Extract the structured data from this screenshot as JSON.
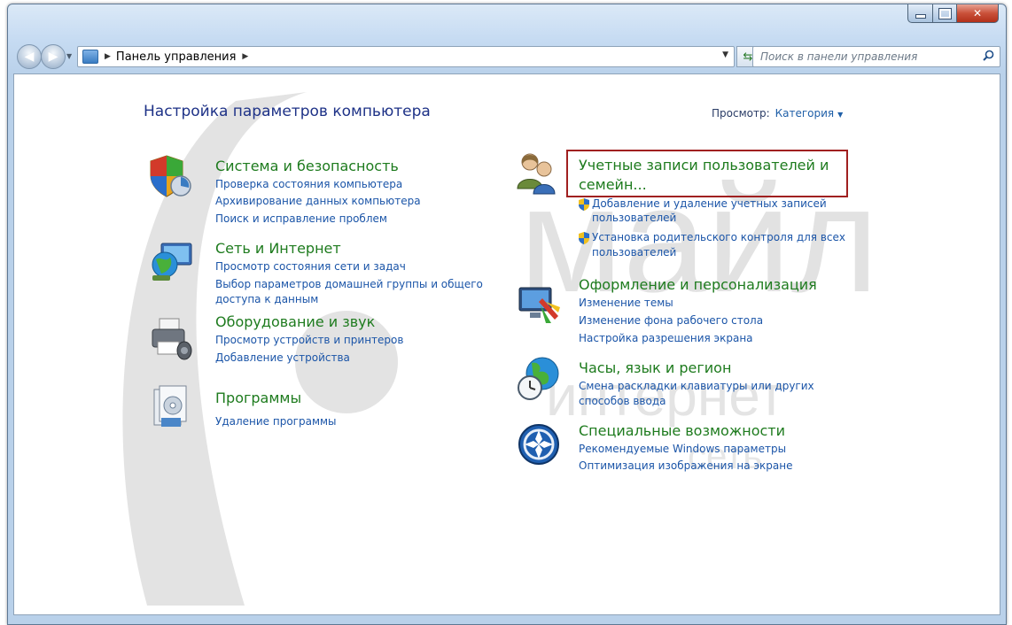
{
  "address": {
    "crumb": "Панель управления",
    "search_placeholder": "Поиск в панели управления"
  },
  "header": {
    "title": "Настройка параметров компьютера",
    "view_label": "Просмотр:",
    "view_value": "Категория"
  },
  "left": [
    {
      "icon": "shield-icon",
      "title": "Система и безопасность",
      "links": [
        "Проверка состояния компьютера",
        "Архивирование данных компьютера",
        "Поиск и исправление проблем"
      ]
    },
    {
      "icon": "network-icon",
      "title": "Сеть и Интернет",
      "links": [
        "Просмотр состояния сети и задач",
        "Выбор параметров домашней группы и общего",
        "доступа к данным"
      ]
    },
    {
      "icon": "printer-icon",
      "title": "Оборудование и звук",
      "links": [
        "Просмотр устройств и принтеров",
        "Добавление устройства"
      ]
    },
    {
      "icon": "programs-icon",
      "title": "Программы",
      "links": [
        "Удаление программы"
      ]
    }
  ],
  "right": [
    {
      "icon": "users-icon",
      "title_line1": "Учетные записи пользователей и",
      "title_line2": "семейн...",
      "links": [
        {
          "line1": "Добавление и удаление учетных записей",
          "line2": "пользователей"
        },
        {
          "line1": "Установка родительского контроля для всех",
          "line2": "пользователей"
        }
      ]
    },
    {
      "icon": "personalization-icon",
      "title": "Оформление и персонализация",
      "links": [
        "Изменение темы",
        "Изменение фона рабочего стола",
        "Настройка разрешения экрана"
      ]
    },
    {
      "icon": "globe-clock-icon",
      "title": "Часы, язык и регион",
      "links": [
        "Смена раскладки клавиатуры или других",
        "способов ввода"
      ]
    },
    {
      "icon": "accessibility-icon",
      "title": "Специальные возможности",
      "links": [
        "Рекомендуемые Windows параметры",
        "Оптимизация изображения на экране"
      ]
    }
  ],
  "colors": {
    "category_title": "#1e7b1e",
    "link": "#1b55a8",
    "highlight": "#a02020"
  }
}
